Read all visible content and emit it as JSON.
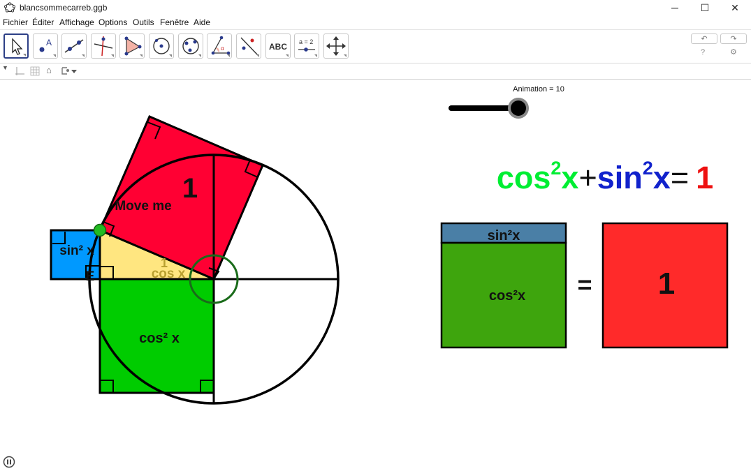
{
  "window": {
    "title": "blancsommecarreb.ggb",
    "app_icon": "geogebra-logo-icon",
    "controls": {
      "minimize": "─",
      "maximize": "☐",
      "close": "✕"
    }
  },
  "menu": [
    "Fichier",
    "Éditer",
    "Affichage",
    "Options",
    "Outils",
    "Fenêtre",
    "Aide"
  ],
  "toolbar": {
    "tools": [
      "move-tool-icon",
      "point-tool-icon",
      "line-tool-icon",
      "perpendicular-line-tool-icon",
      "polygon-tool-icon",
      "circle-tool-icon",
      "conic-tool-icon",
      "angle-tool-icon",
      "reflect-tool-icon",
      "text-tool-icon",
      "slider-tool-icon",
      "move-graphics-view-tool-icon"
    ],
    "text_tool_label": "ABC",
    "slider_tool_label": "a = 2",
    "undo": "↶",
    "redo": "↷",
    "help": "?",
    "settings": "⚙"
  },
  "stylebar": {
    "toggle": "▼",
    "home": "⌂"
  },
  "slider": {
    "label": "Animation = 10",
    "value": 10,
    "min": 0,
    "max": 10
  },
  "figure": {
    "red_square_label": "1",
    "move_me_label": "Move me",
    "blue_square_label": "sin² x",
    "yellow_triangle_label": "cos x",
    "yellow_triangle_side": "1",
    "point_label": "E",
    "green_square_label": "cos² x",
    "colors": {
      "red": "#ff0033",
      "blue": "#0099ff",
      "yellow": "#ffe680",
      "green": "#00cc00",
      "point": "#22bb22"
    }
  },
  "formula": {
    "cos_part": "cos",
    "cos_exp": "2",
    "cos_var": "x",
    "plus": "+",
    "sin_part": "sin",
    "sin_exp": "2",
    "sin_var": "x",
    "equals": "=",
    "one": "1",
    "colors": {
      "cos": "#00ee33",
      "sin": "#1122cc",
      "one": "#ee1111"
    }
  },
  "comparison": {
    "sin_label": "sin²x",
    "cos_label": "cos²x",
    "equals": "=",
    "one": "1",
    "colors": {
      "sin": "#4a7fa6",
      "cos": "#3ea50d",
      "one": "#ff2a2a"
    }
  }
}
